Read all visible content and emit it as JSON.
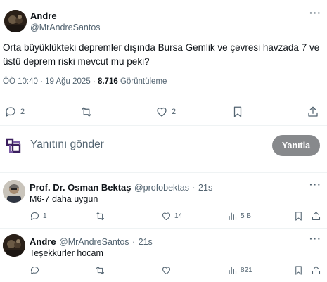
{
  "main_tweet": {
    "author_name": "Andre",
    "author_handle": "@MrAndreSantos",
    "text": "Orta büyüklükteki depremler dışında Bursa Gemlik ve çevresi havzada 7 ve üstü deprem riski mevcut mu peki?",
    "time": "ÖÖ 10:40",
    "sep": "·",
    "date": "19 Ağu 2025",
    "views_count": "8.716",
    "views_label": "Görüntüleme",
    "reply_count": "2",
    "retweet_count": "",
    "like_count": "2"
  },
  "compose": {
    "placeholder": "Yanıtını gönder",
    "button_label": "Yanıtla"
  },
  "replies": [
    {
      "author_name": "Prof. Dr. Osman Bektaş",
      "author_handle": "@profobektas",
      "sep": "·",
      "time_ago": "21s",
      "text": "M6-7 daha uygun",
      "reply_count": "1",
      "retweet_count": "",
      "like_count": "14",
      "views_count": "5 B"
    },
    {
      "author_name": "Andre",
      "author_handle": "@MrAndreSantos",
      "sep": "·",
      "time_ago": "21s",
      "text": "Teşekkürler hocam",
      "reply_count": "",
      "retweet_count": "",
      "like_count": "",
      "views_count": "821"
    }
  ],
  "icons": {
    "reply": "reply-icon",
    "retweet": "retweet-icon",
    "like": "heart-icon",
    "bookmark": "bookmark-icon",
    "share": "share-icon",
    "views": "views-icon",
    "more": "more-icon",
    "compose": "compose-logo-icon"
  },
  "colors": {
    "text_primary": "#0f1419",
    "text_secondary": "#536471",
    "button_bg": "#87898c",
    "divider": "#eff3f4",
    "compose_icon": "#3b1f5e"
  }
}
